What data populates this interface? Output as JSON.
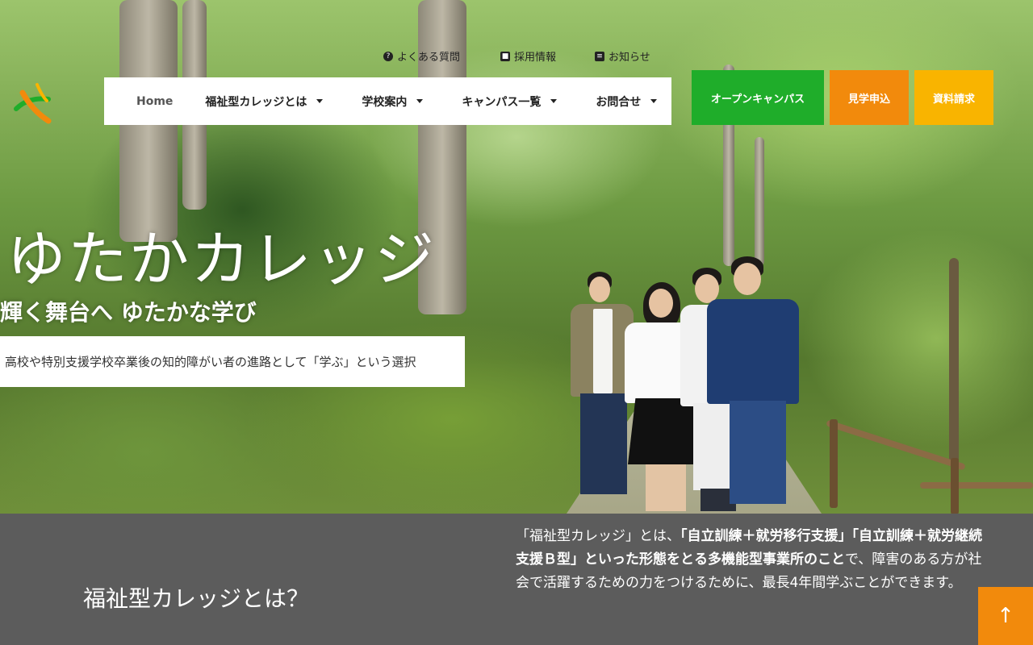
{
  "util_links": [
    {
      "icon": "question-icon",
      "label": "よくある質問"
    },
    {
      "icon": "briefcase-icon",
      "label": "採用情報"
    },
    {
      "icon": "news-icon",
      "label": "お知らせ"
    }
  ],
  "nav": {
    "home": "Home",
    "items": [
      {
        "label": "福祉型カレッジとは"
      },
      {
        "label": "学校案内"
      },
      {
        "label": "キャンパス一覧"
      },
      {
        "label": "お問合せ"
      }
    ]
  },
  "buttons": {
    "open_campus": "オープンキャンパス",
    "visit": "見学申込",
    "brochure": "資料請求"
  },
  "hero": {
    "title": "ゆたかカレッジ",
    "subtitle": "輝く舞台へ ゆたかな学び",
    "description": "高校や特別支援学校卒業後の知的障がい者の進路として「学ぶ」という選択"
  },
  "about": {
    "title": "福祉型カレッジとは？",
    "text_1": "「福祉型カレッジ」とは、",
    "text_bold": "「自立訓練＋就労移行支援」「自立訓練＋就労継続支援Ｂ型」といった形態をとる多機能型事業所のこと",
    "text_2": "で、障害のある方が社会で活躍するための力をつけるために、最長4年間学ぶことができます。"
  },
  "back_to_top": "↑",
  "colors": {
    "green": "#1fad2a",
    "orange": "#f28a0c",
    "yellow": "#f9b400",
    "dark_band": "#5c5c5c"
  }
}
